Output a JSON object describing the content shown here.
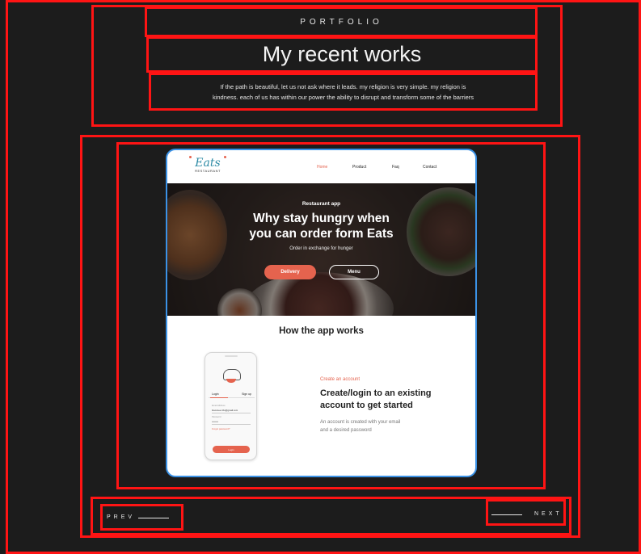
{
  "header": {
    "eyebrow": "PORTFOLIO",
    "title": "My recent works",
    "description_line1": "If the path is beautiful, let us not ask where it leads. my religion is very simple. my religion is",
    "description_line2": "kindness. each of us has within our power the ability to disrupt and transform some of the barriers"
  },
  "project": {
    "logo": {
      "name": "Eats",
      "subtitle": "RESTAURANT"
    },
    "nav": [
      "Home",
      "Product",
      "Faq",
      "Contact"
    ],
    "hero": {
      "eyebrow": "Restaurant app",
      "title_line1": "Why stay hungry when",
      "title_line2": "you can order form Eats",
      "subtitle": "Order in exchange for hunger",
      "primary_button": "Delivery",
      "secondary_button": "Menu"
    },
    "section_title": "How the app works",
    "phone": {
      "tabs": [
        "Login",
        "Sign up"
      ],
      "email_label": "Email Address",
      "email_value": "Ilovemee.info@gmail.com",
      "password_label": "Password",
      "password_value": "••••••••",
      "forgot": "Forgot password?",
      "button": "Login"
    },
    "step": {
      "eyebrow": "Create an account",
      "title_line1": "Create/login to an existing",
      "title_line2": "account to get started",
      "desc_line1": "An account is created with your email",
      "desc_line2": "and a desired password"
    }
  },
  "pager": {
    "prev": "PREV",
    "next": "NEXT"
  },
  "colors": {
    "background": "#1c1c1c",
    "highlight": "#ff1414",
    "accent": "#e5634e",
    "card_border": "#3b92e6"
  }
}
